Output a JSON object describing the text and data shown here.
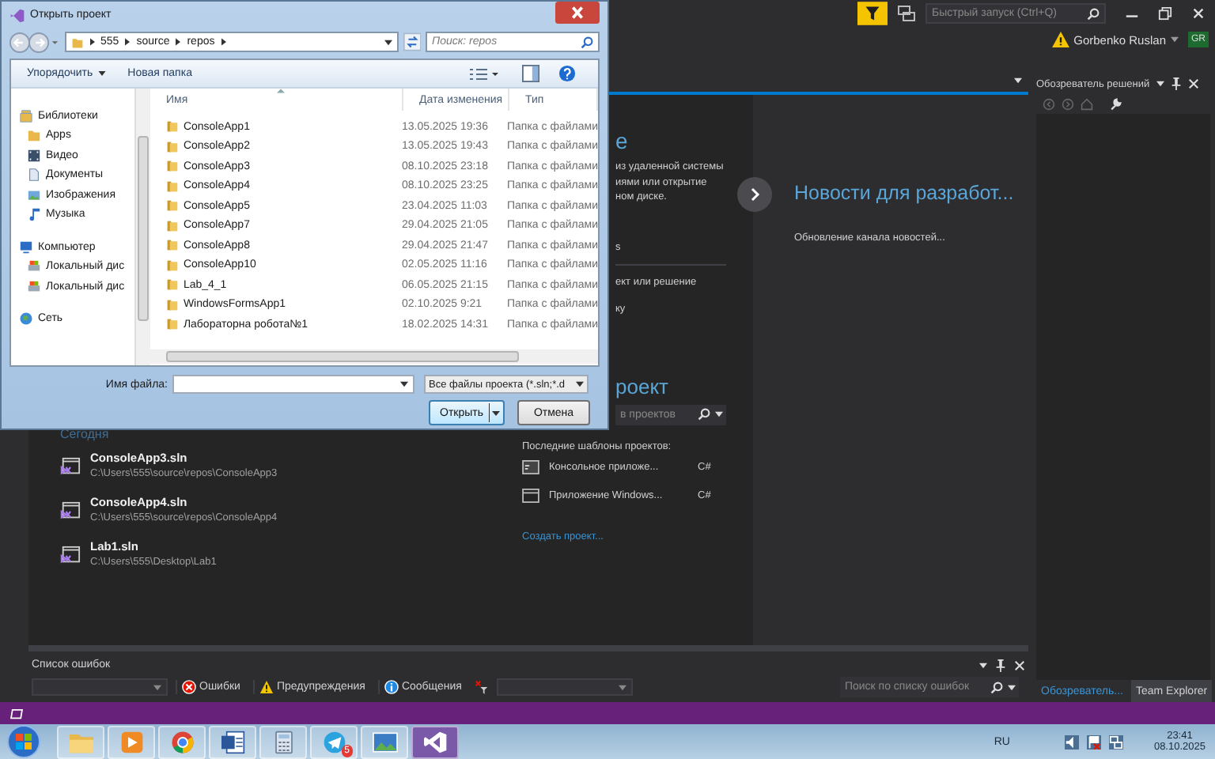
{
  "vs": {
    "quick_launch": {
      "placeholder": "Быстрый запуск (Ctrl+Q)"
    },
    "user": "Gorbenko Ruslan",
    "avatar": "GR",
    "start_page": {
      "open_heading_fragment": "е",
      "open_desc_fragments": [
        "из удаленной системы",
        "иями или открытие",
        "ном диске."
      ],
      "link_fragments": [
        "s",
        "ект или решение",
        "ку"
      ],
      "new_heading_fragment": "роект",
      "template_search": {
        "placeholder": "в проектов"
      },
      "recent_group": "Сегодня",
      "recent": [
        {
          "name": "ConsoleApp3.sln",
          "path": "C:\\Users\\555\\source\\repos\\ConsoleApp3"
        },
        {
          "name": "ConsoleApp4.sln",
          "path": "C:\\Users\\555\\source\\repos\\ConsoleApp4"
        },
        {
          "name": "Lab1.sln",
          "path": "C:\\Users\\555\\Desktop\\Lab1"
        }
      ],
      "templates_label": "Последние шаблоны проектов:",
      "templates": [
        {
          "name": "Консольное приложе...",
          "lang": "C#",
          "kind": "console"
        },
        {
          "name": "Приложение Windows...",
          "lang": "C#",
          "kind": "window"
        }
      ],
      "create_link": "Создать проект...",
      "news_title": "Новости для разработ...",
      "news_status": "Обновление канала новостей..."
    },
    "solution_explorer": {
      "title": "Обозреватель решений"
    },
    "error_list": {
      "title": "Список ошибок",
      "filters": [
        {
          "label": "Ошибки",
          "kind": "error"
        },
        {
          "label": "Предупреждения",
          "kind": "warning"
        },
        {
          "label": "Сообщения",
          "kind": "info"
        }
      ],
      "search": {
        "placeholder": "Поиск по списку ошибок"
      }
    },
    "bottom_tabs": [
      {
        "label": "Обозреватель...",
        "selected": true
      },
      {
        "label": "Team Explorer",
        "selected": false
      }
    ]
  },
  "dialog": {
    "title": "Открыть проект",
    "path": [
      "555",
      "source",
      "repos"
    ],
    "search": {
      "placeholder": "Поиск: repos"
    },
    "toolbar": [
      {
        "label": "Упорядочить",
        "dropdown": true
      },
      {
        "label": "Новая папка",
        "dropdown": false
      }
    ],
    "nav": [
      {
        "label": "Библиотеки",
        "kind": "library",
        "children": [
          {
            "label": "Apps",
            "kind": "folder"
          },
          {
            "label": "Видео",
            "kind": "video"
          },
          {
            "label": "Документы",
            "kind": "documents"
          },
          {
            "label": "Изображения",
            "kind": "pictures"
          },
          {
            "label": "Музыка",
            "kind": "music"
          }
        ]
      },
      {
        "label": "Компьютер",
        "kind": "computer",
        "children": [
          {
            "label": "Локальный дис",
            "kind": "drive"
          },
          {
            "label": "Локальный дис",
            "kind": "drive"
          }
        ]
      },
      {
        "label": "Сеть",
        "kind": "network"
      }
    ],
    "columns": [
      "Имя",
      "Дата изменения",
      "Тип"
    ],
    "rows": [
      {
        "name": "ConsoleApp1",
        "date": "13.05.2025 19:36",
        "type": "Папка с файлами"
      },
      {
        "name": "ConsoleApp2",
        "date": "13.05.2025 19:43",
        "type": "Папка с файлами"
      },
      {
        "name": "ConsoleApp3",
        "date": "08.10.2025 23:18",
        "type": "Папка с файлами"
      },
      {
        "name": "ConsoleApp4",
        "date": "08.10.2025 23:25",
        "type": "Папка с файлами"
      },
      {
        "name": "ConsoleApp5",
        "date": "23.04.2025 11:03",
        "type": "Папка с файлами"
      },
      {
        "name": "ConsoleApp7",
        "date": "29.04.2025 21:05",
        "type": "Папка с файлами"
      },
      {
        "name": "ConsoleApp8",
        "date": "29.04.2025 21:47",
        "type": "Папка с файлами"
      },
      {
        "name": "ConsoleApp10",
        "date": "02.05.2025 11:16",
        "type": "Папка с файлами"
      },
      {
        "name": "Lab_4_1",
        "date": "06.05.2025 21:15",
        "type": "Папка с файлами"
      },
      {
        "name": "WindowsFormsApp1",
        "date": "02.10.2025 9:21",
        "type": "Папка с файлами"
      },
      {
        "name": "Лабораторна робота№1",
        "date": "18.02.2025 14:31",
        "type": "Папка с файлами"
      }
    ],
    "file_name_label": "Имя файла:",
    "file_type": "Все файлы проекта (*.sln;*.d",
    "buttons": [
      {
        "label": "Открыть",
        "kind": "split",
        "default": true
      },
      {
        "label": "Отмена",
        "kind": "plain",
        "default": false
      }
    ]
  },
  "taskbar": {
    "apps": [
      {
        "kind": "explorer",
        "selected": false
      },
      {
        "kind": "media",
        "selected": false
      },
      {
        "kind": "browser",
        "selected": false
      },
      {
        "kind": "word",
        "selected": false
      },
      {
        "kind": "calculator",
        "selected": false
      },
      {
        "kind": "telegram",
        "selected": false,
        "badge": "5"
      },
      {
        "kind": "photos",
        "selected": false
      },
      {
        "kind": "vs",
        "selected": true
      }
    ],
    "language": "RU",
    "time": "23:41",
    "date": "08.10.2025"
  }
}
